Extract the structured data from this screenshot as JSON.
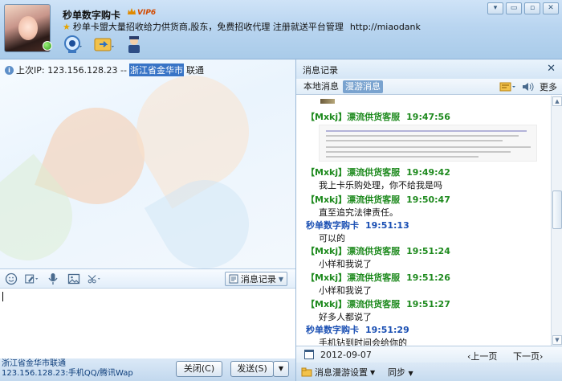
{
  "header": {
    "nickname": "秒单数字购卡",
    "vip_badge": "VIP6",
    "signature": "秒单卡盟大量招收给力供货商,股东，免费招收代理 注册就送平台管理",
    "url": "http://miaodank",
    "window_buttons": [
      "▾",
      "▭",
      "▫",
      "✕"
    ]
  },
  "chat": {
    "ip_prefix": "上次IP:  123.156.128.23  --  ",
    "ip_location": "浙江省金华市",
    "ip_isp": "  联通"
  },
  "input_toolbar": {
    "message_log_label": "消息记录"
  },
  "footer": {
    "status_line1": "浙江省金华市联通",
    "status_line2": "123.156.128.23:手机QQ/腾讯Wap",
    "close_label": "关闭(C)",
    "send_label": "发送(S)"
  },
  "history": {
    "title": "消息记录",
    "tab_local": "本地消息",
    "tab_roam": "漫游消息",
    "more_label": "更多",
    "messages": [
      {
        "sender": "【Mxkj】漂流供货客服",
        "time": "19:47:56",
        "body": ""
      },
      {
        "sender": "【Mxkj】漂流供货客服",
        "time": "19:49:42",
        "body": "我上卡乐购处理，你不给我是吗"
      },
      {
        "sender": "【Mxkj】漂流供货客服",
        "time": "19:50:47",
        "body": "直至追究法律责任。"
      },
      {
        "sender": "秒单数字购卡",
        "time": "19:51:13",
        "body": "可以的"
      },
      {
        "sender": "【Mxkj】漂流供货客服",
        "time": "19:51:24",
        "body": "小样和我说了"
      },
      {
        "sender": "【Mxkj】漂流供货客服",
        "time": "19:51:26",
        "body": "小样和我说了"
      },
      {
        "sender": "【Mxkj】漂流供货客服",
        "time": "19:51:27",
        "body": "好多人都说了"
      },
      {
        "sender": "秒单数字购卡",
        "time": "19:51:29",
        "body": "手机钻到时间会给你的"
      }
    ],
    "date": "2012-09-07",
    "prev_page": "‹上一页",
    "next_page": "下一页›",
    "roam_settings": "消息漫游设置",
    "sync": "同步"
  }
}
